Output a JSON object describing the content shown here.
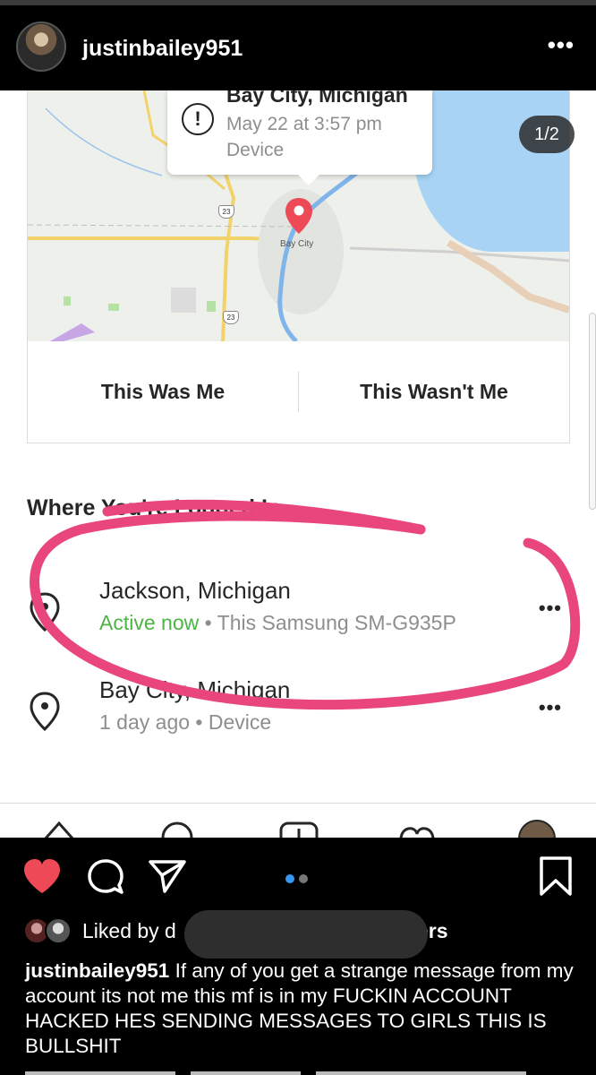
{
  "header": {
    "username": "justinbailey951",
    "more_label": "•••"
  },
  "post": {
    "pager": "1/2",
    "callout": {
      "icon": "!",
      "location": "Bay City, Michigan",
      "time": "May 22 at 3:57 pm",
      "device": "Device"
    },
    "map": {
      "city_label": "Bay City",
      "highway_label": "23"
    },
    "buttons": {
      "this_was_me": "This Was Me",
      "this_wasnt_me": "This Wasn't Me"
    },
    "section_title": "Where You're Logged In",
    "sessions": [
      {
        "place": "Jackson, Michigan",
        "status": "Active now",
        "separator": " • ",
        "device": "This Samsung SM-G935P"
      },
      {
        "place": "Bay City, Michigan",
        "status": "1 day ago",
        "separator": " • ",
        "device": "Device"
      }
    ],
    "more_label": "•••",
    "annotation_color": "#e8467c"
  },
  "likes": {
    "prefix": "Liked by d",
    "suffix": "ers"
  },
  "caption": {
    "username": "justinbailey951",
    "text": " If any of you get a strange message from my account its not me this mf is in my FUCKIN ACCOUNT HACKED HES SENDING MESSAGES TO GIRLS THIS IS BULLSHIT"
  },
  "colors": {
    "like_red": "#ed4956",
    "carousel_active": "#3897f0",
    "active_green": "#4bb543"
  }
}
